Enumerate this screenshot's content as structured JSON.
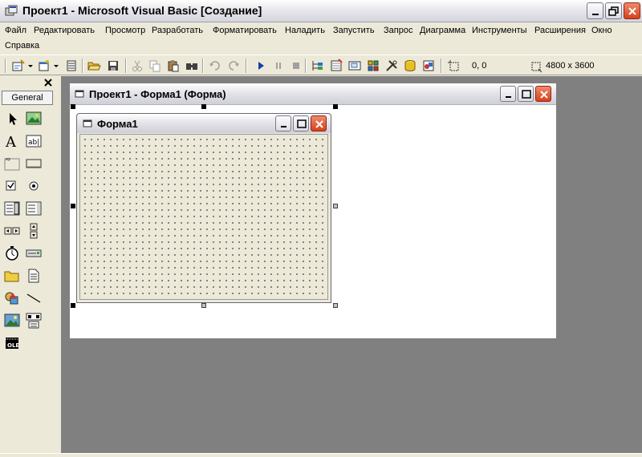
{
  "window": {
    "title": "Проект1 - Microsoft Visual Basic [Создание]"
  },
  "menu": {
    "items": [
      "Файл",
      "Редактировать",
      "Просмотр",
      "Разработать",
      "Форматировать",
      "Наладить",
      "Запустить",
      "Запрос",
      "Диаграмма",
      "Инструменты",
      "Расширения",
      "Окно",
      "Справка"
    ]
  },
  "toolbar": {
    "icons": [
      "add-project-icon",
      "add-form-icon",
      "menu-editor-icon",
      "open-icon",
      "save-icon",
      "cut-icon",
      "copy-icon",
      "paste-icon",
      "find-icon",
      "undo-icon",
      "redo-icon",
      "start-icon",
      "break-icon",
      "end-icon",
      "project-explorer-icon",
      "properties-window-icon",
      "form-layout-icon",
      "object-browser-icon",
      "toolbox-icon",
      "data-view-icon",
      "component-manager-icon"
    ],
    "position": "0, 0",
    "size": "4800 x 3600"
  },
  "toolbox": {
    "tab_label": "General",
    "tools": [
      "pointer",
      "picturebox",
      "label",
      "textbox",
      "frame",
      "commandbutton",
      "checkbox",
      "optionbutton",
      "combobox",
      "listbox",
      "hscrollbar",
      "vscrollbar",
      "timer",
      "drivelistbox",
      "dirlistbox",
      "filelistbox",
      "shape",
      "line",
      "image",
      "data",
      "ole"
    ]
  },
  "designer": {
    "window_title": "Проект1 - Форма1 (Форма)",
    "form_caption": "Форма1"
  },
  "colors": {
    "workspace": "#808080",
    "chrome": "#ece9d8",
    "close_button": "#d8401c"
  }
}
